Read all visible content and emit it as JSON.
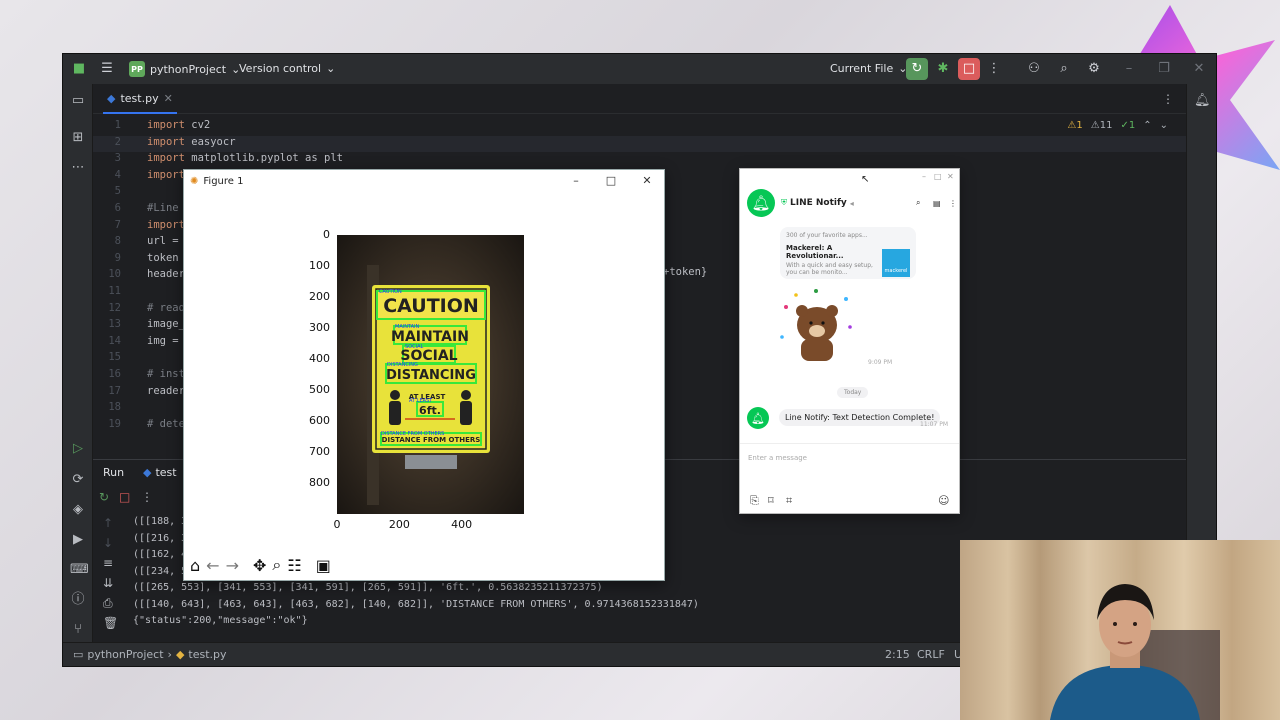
{
  "ide": {
    "project_badge": "PP",
    "project_name": "pythonProject",
    "version_control": "Version control",
    "run_config": "Current File",
    "tab_file": "test.py",
    "inspections": {
      "warnings": "1",
      "weak_warnings": "11",
      "ok": "1"
    },
    "code_lines": [
      {
        "n": "1",
        "kw": "import",
        "rest": " cv2"
      },
      {
        "n": "2",
        "kw": "import",
        "rest": " easyocr"
      },
      {
        "n": "3",
        "kw": "import",
        "rest": " matplotlib.pyplot as plt"
      },
      {
        "n": "4",
        "kw": "import",
        "rest": ""
      },
      {
        "n": "5",
        "kw": "",
        "rest": ""
      },
      {
        "n": "6",
        "kw": "",
        "rest": "#Line"
      },
      {
        "n": "7",
        "kw": "import",
        "rest": ""
      },
      {
        "n": "8",
        "kw": "",
        "rest": "url ="
      },
      {
        "n": "9",
        "kw": "",
        "rest": "token"
      },
      {
        "n": "10",
        "kw": "",
        "rest": "headers"
      },
      {
        "n": "11",
        "kw": "",
        "rest": ""
      },
      {
        "n": "12",
        "kw": "",
        "rest": "# read"
      },
      {
        "n": "13",
        "kw": "",
        "rest": "image_"
      },
      {
        "n": "14",
        "kw": "",
        "rest": "img ="
      },
      {
        "n": "15",
        "kw": "",
        "rest": ""
      },
      {
        "n": "16",
        "kw": "",
        "rest": "# insta"
      },
      {
        "n": "17",
        "kw": "",
        "rest": "reader"
      },
      {
        "n": "18",
        "kw": "",
        "rest": ""
      },
      {
        "n": "19",
        "kw": "",
        "rest": "# dete"
      }
    ],
    "code_fragment_right": "+token}",
    "run_tab": "Run",
    "run_config_tab": "test",
    "console_lines": [
      "([[188, 3",
      "([[216, 3",
      "([[162, 4",
      "([[234, 5",
      "([[265, 553], [341, 553], [341, 591], [265, 591]], '6ft.', 0.5638235211372375)",
      "([[140, 643], [463, 643], [463, 682], [140, 682]], 'DISTANCE FROM OTHERS', 0.9714368152331847)",
      "{\"status\":200,\"message\":\"ok\"}"
    ],
    "status": {
      "project": "pythonProject",
      "file": "test.py",
      "position": "2:15",
      "line_sep": "CRLF",
      "encoding": "U"
    }
  },
  "figure": {
    "title": "Figure 1",
    "y_ticks": [
      "0",
      "100",
      "200",
      "300",
      "400",
      "500",
      "600",
      "700",
      "800"
    ],
    "x_ticks": [
      "0",
      "200",
      "400"
    ],
    "sign_lines": [
      "CAUTION",
      "MAINTAIN",
      "SOCIAL",
      "DISTANCING",
      "AT LEAST",
      "6ft.",
      "DISTANCE FROM OTHERS"
    ],
    "sign_small": [
      "CAUTION",
      "MAINTAIN",
      "SOCIAL",
      "DISTANCING",
      "AT LEAST",
      "DISTANCE FROM OTHERS"
    ]
  },
  "line": {
    "chat_name": "LINE Notify",
    "card_snippet": "300 of your favorite apps...",
    "card_title": "Mackerel: A Revolutionar...",
    "card_body": "With a quick and easy setup, you can be monito...",
    "card_logo": "mackerel",
    "sticker_time": "9:09 PM",
    "date_divider": "Today",
    "message": "Line Notify: Text Detection Complete!",
    "message_time": "11:07 PM",
    "input_placeholder": "Enter a message"
  },
  "colors": {
    "ide_bg": "#1e1f22",
    "accent_green": "#57965c",
    "stop_red": "#db5c5c",
    "line_green": "#06c755",
    "sign_yellow": "#e8e23a",
    "ocr_box": "#39e83a"
  }
}
